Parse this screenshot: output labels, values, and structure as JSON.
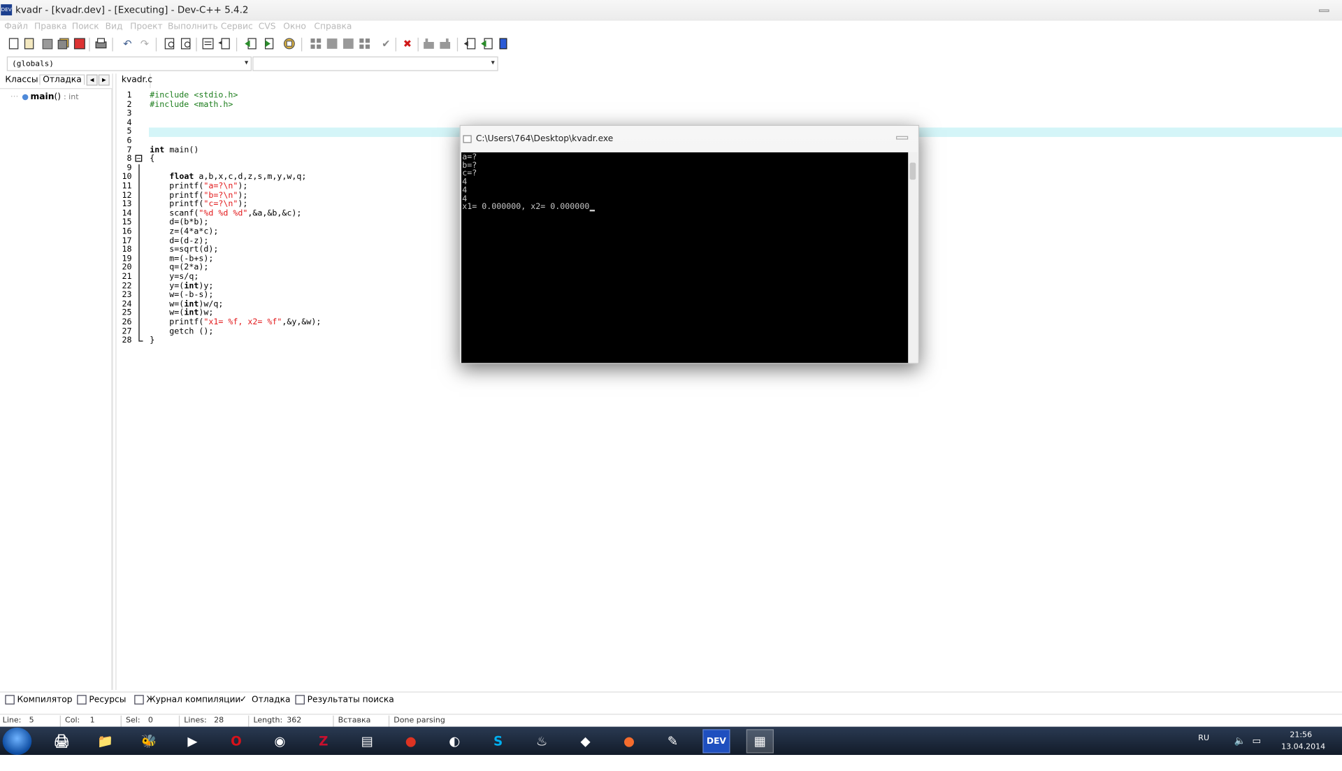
{
  "window": {
    "title": "kvadr - [kvadr.dev] - [Executing] - Dev-C++ 5.4.2"
  },
  "menu": [
    "Файл",
    "Правка",
    "Поиск",
    "Вид",
    "Проект",
    "Выполнить",
    "Сервис",
    "CVS",
    "Окно",
    "Справка"
  ],
  "combos": {
    "scope": "(globals)",
    "member": ""
  },
  "left_panel": {
    "tabs": [
      "Классы",
      "Отладка"
    ],
    "tree": [
      {
        "name": "main",
        "parens": "()",
        "type": ": int"
      }
    ]
  },
  "editor": {
    "file_tab": "kvadr.c",
    "highlighted_line": 5,
    "lines": [
      {
        "n": "1",
        "t": "#include <stdio.h>",
        "k": "pp"
      },
      {
        "n": "2",
        "t": "#include <math.h>",
        "k": "pp"
      },
      {
        "n": "3",
        "t": ""
      },
      {
        "n": "4",
        "t": ""
      },
      {
        "n": "5",
        "t": ""
      },
      {
        "n": "6",
        "t": ""
      },
      {
        "n": "7",
        "t": "int main()",
        "k": "sig"
      },
      {
        "n": "8",
        "t": "{"
      },
      {
        "n": "9",
        "t": ""
      },
      {
        "n": "10",
        "t": "    float a,b,x,c,d,z,s,m,y,w,q;",
        "k": "decl"
      },
      {
        "n": "11",
        "t": "    printf(\"a=?\\n\");",
        "k": "str"
      },
      {
        "n": "12",
        "t": "    printf(\"b=?\\n\");",
        "k": "str"
      },
      {
        "n": "13",
        "t": "    printf(\"c=?\\n\");",
        "k": "str"
      },
      {
        "n": "14",
        "t": "    scanf(\"%d %d %d\",&a,&b,&c);",
        "k": "str"
      },
      {
        "n": "15",
        "t": "    d=(b*b);"
      },
      {
        "n": "16",
        "t": "    z=(4*a*c);"
      },
      {
        "n": "17",
        "t": "    d=(d-z);"
      },
      {
        "n": "18",
        "t": "    s=sqrt(d);"
      },
      {
        "n": "19",
        "t": "    m=(-b+s);"
      },
      {
        "n": "20",
        "t": "    q=(2*a);"
      },
      {
        "n": "21",
        "t": "    y=s/q;"
      },
      {
        "n": "22",
        "t": "    y=(int)y;",
        "k": "cast"
      },
      {
        "n": "23",
        "t": "    w=(-b-s);"
      },
      {
        "n": "24",
        "t": "    w=(int)w/q;",
        "k": "cast"
      },
      {
        "n": "25",
        "t": "    w=(int)w;",
        "k": "cast"
      },
      {
        "n": "26",
        "t": "    printf(\"x1= %f, x2= %f\",&y,&w);",
        "k": "str"
      },
      {
        "n": "27",
        "t": "    getch ();"
      },
      {
        "n": "28",
        "t": "}"
      }
    ]
  },
  "console": {
    "title": "C:\\Users\\764\\Desktop\\kvadr.exe",
    "output": [
      "a=?",
      "b=?",
      "c=?",
      "4",
      "4",
      "4",
      "x1= 0.000000, x2= 0.000000"
    ]
  },
  "bottom_tabs": [
    "Компилятор",
    "Ресурсы",
    "Журнал компиляции",
    "Отладка",
    "Результаты поиска"
  ],
  "status": {
    "line_label": "Line:",
    "line": "5",
    "col_label": "Col:",
    "col": "1",
    "sel_label": "Sel:",
    "sel": "0",
    "lines_label": "Lines:",
    "lines": "28",
    "length_label": "Length:",
    "length": "362",
    "mode": "Вставка",
    "message": "Done parsing"
  },
  "taskbar": {
    "apps": [
      "explorer-icon",
      "folder-icon",
      "foobar-icon",
      "media-player-icon",
      "opera-icon",
      "browser-icon",
      "filezilla-icon",
      "terminal-icon",
      "chrome-icon",
      "media-icon",
      "skype-icon",
      "steam-icon",
      "devtool-icon",
      "origin-icon",
      "paint-icon",
      "devcpp-icon",
      "notes-icon"
    ],
    "lang": "RU",
    "time": "21:56",
    "date": "13.04.2014"
  },
  "colors": {
    "preprocessor": "#1c7d1c",
    "string": "#e2191b",
    "highlight": "#d4f5f8"
  }
}
